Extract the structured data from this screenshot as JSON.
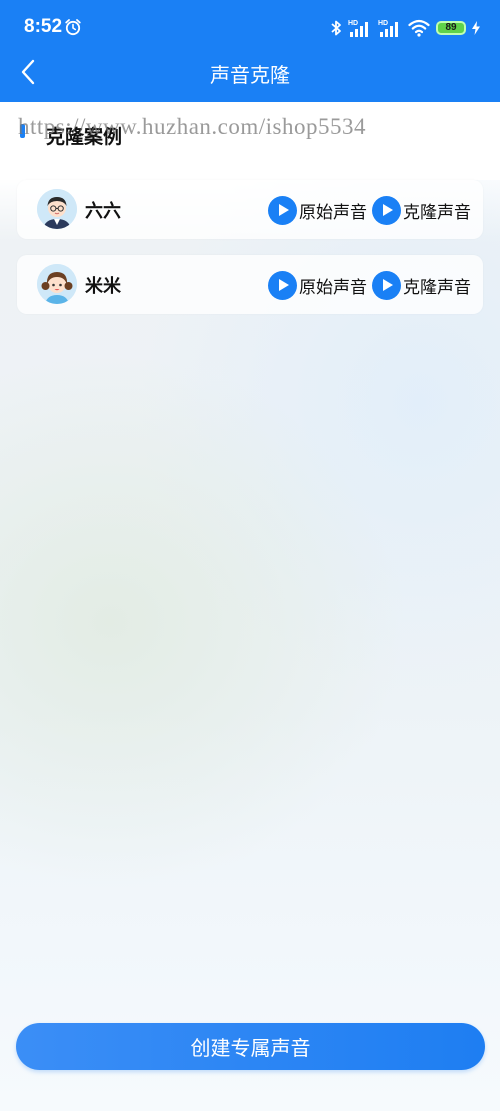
{
  "status_bar": {
    "time": "8:52",
    "battery": "89"
  },
  "nav": {
    "title": "声音克隆"
  },
  "section": {
    "title": "克隆案例"
  },
  "watermark": "https://www.huzhan.com/ishop5534",
  "cases": [
    {
      "name": "六六",
      "original_label": "原始声音",
      "clone_label": "克隆声音"
    },
    {
      "name": "米米",
      "original_label": "原始声音",
      "clone_label": "克隆声音"
    }
  ],
  "create_button": {
    "label": "创建专属声音"
  },
  "colors": {
    "accent": "#1a80f5"
  }
}
